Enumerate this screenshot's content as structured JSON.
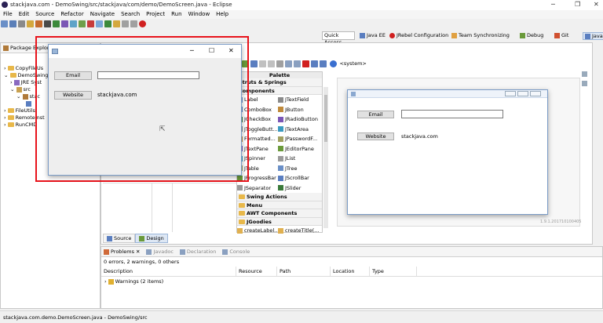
{
  "window": {
    "title": "stackjava.com - DemoSwing/src/stackjava/com/demo/DemoScreen.java - Eclipse"
  },
  "menubar": {
    "items": [
      "File",
      "Edit",
      "Source",
      "Refactor",
      "Navigate",
      "Search",
      "Project",
      "Run",
      "Window",
      "Help"
    ]
  },
  "perspectives": {
    "quick_access": "Quick Access",
    "items": [
      "Java EE",
      "JRebel Configuration",
      "Team Synchronizing",
      "Debug",
      "Git",
      "Java"
    ]
  },
  "package_explorer": {
    "tab_label": "Package Explorer",
    "tree": [
      "CopyFileUs",
      "DemoSwing",
      "JRE Syst",
      "src",
      "stac",
      "FileUtils",
      "RemoteInst",
      "RunCMD"
    ]
  },
  "running_app": {
    "email_label": "Email",
    "website_label": "Website",
    "website_value": "stackjava.com"
  },
  "palette": {
    "title": "Palette",
    "categories_top": [
      "Struts & Springs",
      "Components"
    ],
    "components": [
      [
        "Label",
        "JTextField"
      ],
      [
        "ComboBox",
        "JButton"
      ],
      [
        "JCheckBox",
        "JRadioButton"
      ],
      [
        "JToggleButt...",
        "JTextArea"
      ],
      [
        "Formatted...",
        "JPasswordF..."
      ],
      [
        "JTextPane",
        "JEditorPane"
      ],
      [
        "JSpinner",
        "JList"
      ],
      [
        "JTable",
        "JTree"
      ],
      [
        "JProgressBar",
        "JScrollBar"
      ],
      [
        "JSeparator",
        "JSlider"
      ]
    ],
    "categories_bottom": [
      "Swing Actions",
      "Menu",
      "AWT Components",
      "JGoodies"
    ],
    "goodies_items": [
      "createLabel...",
      "createTitle(..."
    ]
  },
  "editor": {
    "system_combo": "<system>",
    "design_email": "Email",
    "design_website": "Website",
    "design_website_value": "stackjava.com",
    "version": "1.9.1.201710100405",
    "tabs": [
      "Source",
      "Design"
    ]
  },
  "problems": {
    "tabs": [
      "Problems",
      "Javadoc",
      "Declaration",
      "Console"
    ],
    "summary": "0 errors, 2 warnings, 0 others",
    "columns": [
      "Description",
      "Resource",
      "Path",
      "Location",
      "Type"
    ],
    "row": "Warnings (2 items)"
  },
  "statusbar": {
    "text": "stackjava.com.demo.DemoScreen.java - DemoSwing/src"
  },
  "colors": {
    "accent_red": "#e8131b",
    "folder": "#e8b84a",
    "window_border": "#7a9bc6"
  }
}
